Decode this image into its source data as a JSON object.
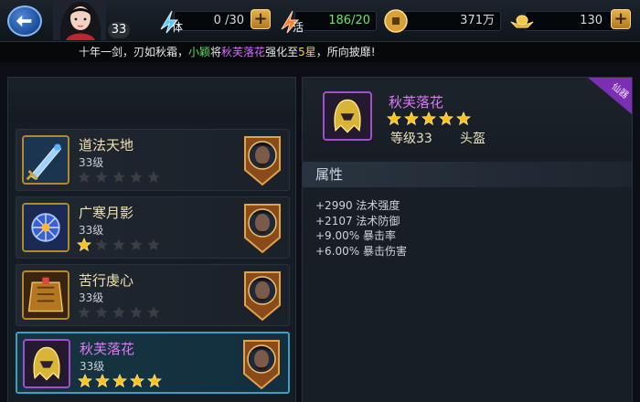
{
  "top_bar": {
    "player_level": "33",
    "stamina": {
      "label": "体",
      "value": "0 /30"
    },
    "vitality": {
      "label": "活",
      "value": "186/20"
    },
    "coins": {
      "value": "371万"
    },
    "ingots": {
      "value": "130"
    }
  },
  "ticker": {
    "prefix": "十年一剑，刃如秋霜，",
    "player": "小颖",
    "mid": "将",
    "item": "秋芙落花",
    "mid2": "强化至",
    "grade": "5星",
    "suffix": "，所向披靡!"
  },
  "items": [
    {
      "name": "道法天地",
      "level": "33级",
      "stars": 0,
      "quality": "gold",
      "selected": false
    },
    {
      "name": "广寒月影",
      "level": "33级",
      "stars": 1,
      "quality": "gold",
      "selected": false
    },
    {
      "name": "苦行虔心",
      "level": "33级",
      "stars": 0,
      "quality": "gold",
      "selected": false
    },
    {
      "name": "秋芙落花",
      "level": "33级",
      "stars": 5,
      "quality": "purple",
      "selected": true
    }
  ],
  "detail": {
    "name": "秋芙落花",
    "stars": 5,
    "level": "等级33",
    "slot": "头盔",
    "corner_tag": "仙器",
    "attr_title": "属性",
    "attributes": [
      "+2990 法术强度",
      "+2107 法术防御",
      "+9.00% 暴击率",
      "+6.00% 暴击伤害"
    ]
  },
  "colors": {
    "gold_star": "#ffc21a",
    "empty_star": "#3a3f45",
    "purple_quality": "#a04fd0",
    "selected_border": "#3f9fc2"
  }
}
